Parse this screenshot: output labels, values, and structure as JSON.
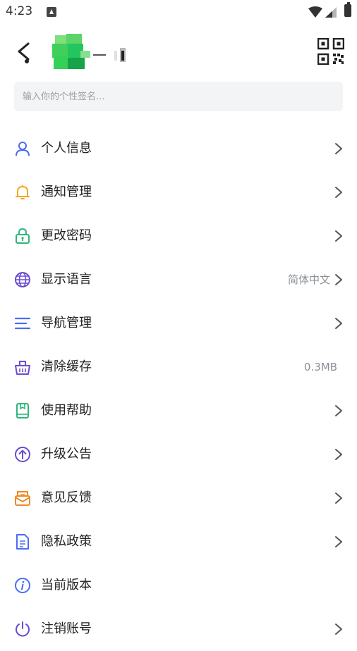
{
  "status_bar": {
    "time": "4:23"
  },
  "header": {
    "back_icon": "back-arrow-icon",
    "qr_icon": "qr-code-icon"
  },
  "signature": {
    "placeholder": "输入你的个性签名..."
  },
  "menu": {
    "items": [
      {
        "label": "个人信息",
        "value": "",
        "icon": "person-icon",
        "color": "#4a6cf7",
        "arrow": true
      },
      {
        "label": "通知管理",
        "value": "",
        "icon": "bell-icon",
        "color": "#f5a623",
        "arrow": true
      },
      {
        "label": "更改密码",
        "value": "",
        "icon": "lock-icon",
        "color": "#2fb67c",
        "arrow": true
      },
      {
        "label": "显示语言",
        "value": "简体中文",
        "icon": "globe-icon",
        "color": "#6a4cd1",
        "arrow": true
      },
      {
        "label": "导航管理",
        "value": "",
        "icon": "menu-lines-icon",
        "color": "#4a6cf7",
        "arrow": true
      },
      {
        "label": "清除缓存",
        "value": "0.3MB",
        "icon": "basket-icon",
        "color": "#6a4cd1",
        "arrow": false
      },
      {
        "label": "使用帮助",
        "value": "",
        "icon": "book-icon",
        "color": "#2fb67c",
        "arrow": true
      },
      {
        "label": "升级公告",
        "value": "",
        "icon": "upgrade-icon",
        "color": "#6a4cd1",
        "arrow": true
      },
      {
        "label": "意见反馈",
        "value": "",
        "icon": "envelope-icon",
        "color": "#f08a24",
        "arrow": true
      },
      {
        "label": "隐私政策",
        "value": "",
        "icon": "document-icon",
        "color": "#4a6cf7",
        "arrow": true
      },
      {
        "label": "当前版本",
        "value": "",
        "icon": "info-icon",
        "color": "#4a6cf7",
        "arrow": false
      },
      {
        "label": "注销账号",
        "value": "",
        "icon": "power-icon",
        "color": "#6a4cd1",
        "arrow": true
      }
    ]
  }
}
